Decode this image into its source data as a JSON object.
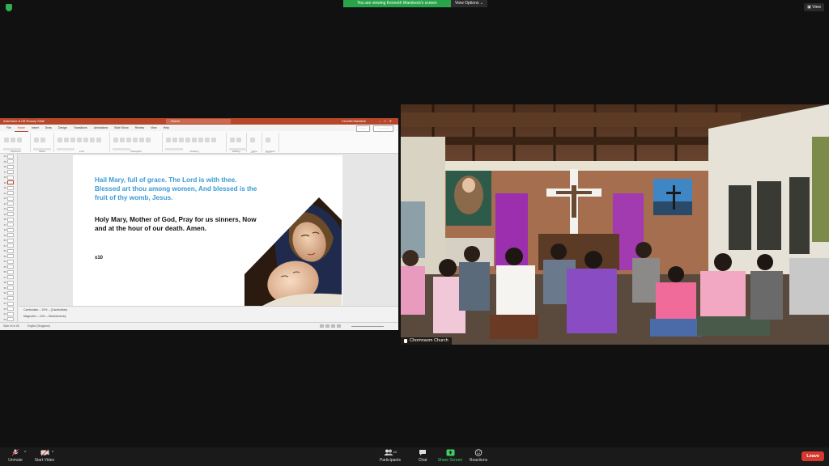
{
  "banner": {
    "viewing_text": "You are viewing Kenneth Wambeck's screen",
    "view_options": "View Options ⌄",
    "view_button": "View"
  },
  "powerpoint": {
    "title": "AutoSave ● Off  Rosary Slide",
    "search": "Search",
    "user": "Kenneth Wambeck",
    "tabs": [
      "File",
      "Home",
      "Insert",
      "Draw",
      "Design",
      "Transitions",
      "Animations",
      "Slide Show",
      "Review",
      "View",
      "Help"
    ],
    "active_tab_index": 1,
    "share_btns": [
      "Share",
      "Comments"
    ],
    "ribbon_groups": [
      "Clipboard",
      "Slides",
      "Font",
      "Paragraph",
      "Drawing",
      "Editing",
      "Voice",
      "Designer"
    ],
    "slide_numbers": [
      "34",
      "35",
      "36",
      "37",
      "38",
      "39",
      "40",
      "41",
      "42",
      "43",
      "44",
      "45",
      "46",
      "47",
      "48",
      "49",
      "50",
      "51",
      "52",
      "53",
      "54",
      "55",
      "56",
      "57",
      "58",
      "59",
      "60",
      "61",
      "62",
      "63",
      "64",
      "65"
    ],
    "selected_slide_index": 5,
    "slide": {
      "prayer1": "Hail Mary, full of grace. The Lord is with thee. Blessed art thou among women, And blessed is the fruit of thy womb, Jesus.",
      "prayer2": "Holy Mary, Mother of God, Pray for us sinners, Now and at the hour of our death. Amen.",
      "repeat": "x10"
    },
    "notes": [
      "Cambodian – 10% – (Cambodian)",
      "Magnolim – 10% – Marinchonrey"
    ],
    "status_left": "Slide 40 of 65",
    "status_mid": "English (Singapore)"
  },
  "video": {
    "participant_name": "Chomnaom Church"
  },
  "toolbar": {
    "unmute": "Unmute",
    "start_video": "Start Video",
    "participants": "Participants",
    "participants_count": "44",
    "chat": "Chat",
    "share_screen": "Share Screen",
    "reactions": "Reactions",
    "leave": "Leave"
  },
  "colors": {
    "accent_green": "#29a44a",
    "ppt_red": "#b7472a",
    "slide_blue": "#3a9bd5",
    "leave_red": "#d63a2f"
  }
}
